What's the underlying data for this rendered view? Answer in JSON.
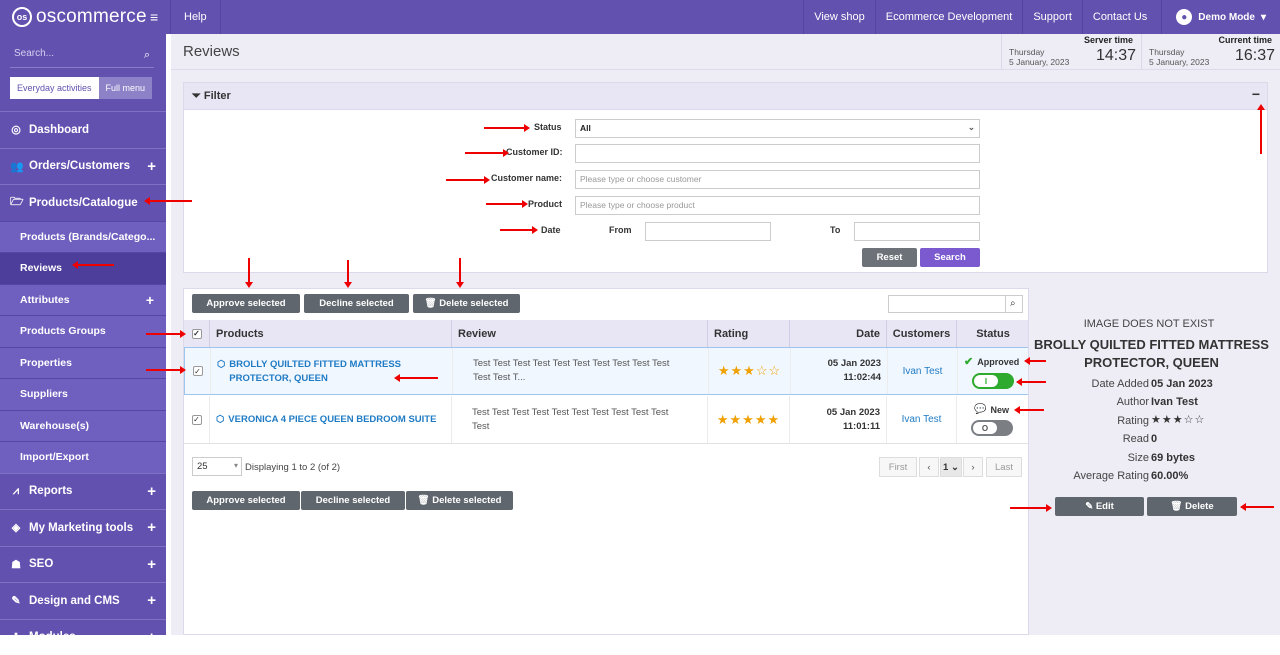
{
  "topbar": {
    "brand": "oscommerce",
    "help": "Help",
    "nav": [
      "View shop",
      "Ecommerce Development",
      "Support",
      "Contact Us"
    ],
    "user": "Demo Mode"
  },
  "sidebar": {
    "search_placeholder": "Search...",
    "modes": [
      "Everyday activities",
      "Full menu"
    ],
    "items": [
      {
        "label": "Dashboard",
        "icon": "dashboard-icon",
        "glyph": "◎"
      },
      {
        "label": "Orders/Customers",
        "icon": "users-icon",
        "glyph": "👥",
        "plus": "+"
      },
      {
        "label": "Products/Catalogue",
        "icon": "folder-open-icon",
        "glyph": "🗁"
      }
    ],
    "subitems": [
      {
        "label": "Products (Brands/Catego..."
      },
      {
        "label": "Reviews",
        "active": true
      },
      {
        "label": "Attributes",
        "plus": "+"
      },
      {
        "label": "Products Groups"
      },
      {
        "label": "Properties"
      },
      {
        "label": "Suppliers"
      },
      {
        "label": "Warehouse(s)"
      },
      {
        "label": "Import/Export"
      }
    ],
    "bottom_items": [
      {
        "label": "Reports",
        "icon": "chart-icon",
        "glyph": "⩘"
      },
      {
        "label": "My Marketing tools",
        "icon": "tag-icon",
        "glyph": "◈"
      },
      {
        "label": "SEO",
        "icon": "sitemap-icon",
        "glyph": "☗"
      },
      {
        "label": "Design and CMS",
        "icon": "brush-icon",
        "glyph": "✎"
      },
      {
        "label": "Modules",
        "icon": "puzzle-icon",
        "glyph": "✚"
      }
    ]
  },
  "page": {
    "title": "Reviews"
  },
  "clocks": [
    {
      "label": "Server time",
      "day": "Thursday",
      "date": "5 January, 2023",
      "time": "14:37"
    },
    {
      "label": "Current time",
      "day": "Thursday",
      "date": "5 January, 2023",
      "time": "16:37"
    }
  ],
  "filter": {
    "title": "Filter",
    "collapse": "−",
    "status_label": "Status",
    "status_value": "All",
    "customer_id_label": "Customer ID:",
    "customer_name_label": "Customer name:",
    "customer_name_placeholder": "Please type or choose customer",
    "product_label": "Product",
    "product_placeholder": "Please type or choose product",
    "date_label": "Date",
    "from_label": "From",
    "to_label": "To",
    "reset": "Reset",
    "search": "Search"
  },
  "actions": {
    "approve": "Approve selected",
    "decline": "Decline selected",
    "delete": "Delete selected"
  },
  "table": {
    "headers": [
      "Products",
      "Review",
      "Rating",
      "Date",
      "Customers",
      "Status"
    ],
    "rows": [
      {
        "product": "BROLLY QUILTED FITTED MATTRESS PROTECTOR, QUEEN",
        "review": "Test Test Test Test Test Test Test Test Test Test Test Test T...",
        "rating": 3,
        "stars": "★★★☆☆",
        "date": "05 Jan 2023",
        "time": "11:02:44",
        "customer": "Ivan Test",
        "status": "Approved",
        "toggle_on": true
      },
      {
        "product": "VERONICA 4 PIECE QUEEN BEDROOM SUITE",
        "review": "Test Test Test Test Test Test Test Test Test Test Test",
        "rating": 5,
        "stars": "★★★★★",
        "date": "05 Jan 2023",
        "time": "11:01:11",
        "customer": "Ivan Test",
        "status": "New",
        "toggle_on": false
      }
    ]
  },
  "pagination": {
    "per_page": "25",
    "displaying": "Displaying 1 to 2 (of 2)",
    "first": "First",
    "page": "1",
    "last": "Last"
  },
  "details": {
    "image_text": "IMAGE DOES NOT EXIST",
    "name": "BROLLY QUILTED FITTED MATTRESS PROTECTOR, QUEEN",
    "date_added_label": "Date Added",
    "date_added": "05 Jan 2023",
    "author_label": "Author",
    "author": "Ivan Test",
    "rating_label": "Rating",
    "rating": 3,
    "stars": "★★★☆☆",
    "read_label": "Read",
    "read": "0",
    "size_label": "Size",
    "size": "69 bytes",
    "avg_label": "Average Rating",
    "avg": "60.00%",
    "edit": "Edit",
    "delete": "Delete"
  },
  "colors": {
    "brand": "#6351b0",
    "link": "#1f7bc4",
    "star": "#f0a000",
    "approve": "#2eaa2e",
    "annotation": "#e00000"
  }
}
